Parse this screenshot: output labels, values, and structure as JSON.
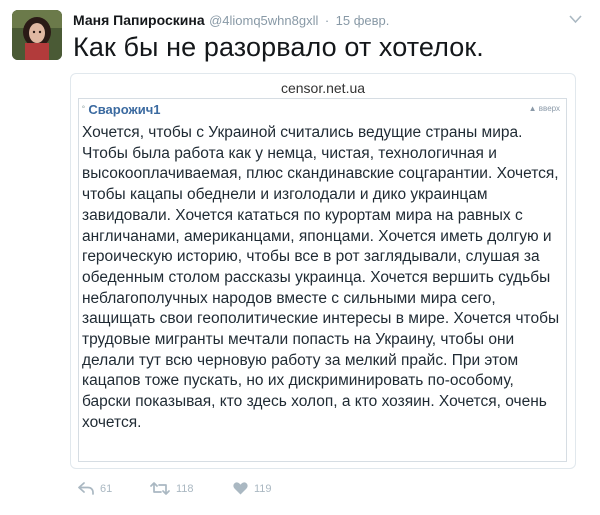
{
  "tweet": {
    "author_name": "Маня Папироскина",
    "author_handle": "@4liomq5whn8gxll",
    "date": "15 февр.",
    "text": "Как бы не разорвало от хотелок."
  },
  "card": {
    "source": "censor.net.ua",
    "comment_user": "Сварожич1",
    "up_link": "вверх",
    "comment_text": "Хочется, чтобы с Украиной считались ведущие страны мира. Чтобы была работа как у немца, чистая, технологичная и высокооплачиваемая, плюс скандинавские соцгарантии. Хочется, чтобы кацапы обеднели и изголодали и дико украинцам завидовали. Хочется кататься по курортам мира на равных с англичанами, американцами, японцами. Хочется иметь долгую и героическую историю, чтобы все в рот заглядывали, слушая за обеденным столом рассказы украинца. Хочется вершить судьбы неблагополучных народов вместе с сильными мира сего, защищать свои геополитические интересы в мире. Хочется чтобы трудовые мигранты мечтали попасть на Украину, чтобы они делали тут всю черновую работу за мелкий прайс. При этом кацапов тоже пускать, но их дискриминировать по-особому, барски показывая, кто здесь холоп, а кто хозяин. Хочется, очень хочется."
  },
  "actions": {
    "reply_count": "61",
    "retweet_count": "118",
    "like_count": "119"
  },
  "icons": {
    "reply": "reply-icon",
    "retweet": "retweet-icon",
    "like": "heart-icon",
    "more": "chevron-down-icon"
  },
  "colors": {
    "link": "#3b6aa0",
    "muted": "#8899a6",
    "icon": "#aab8c2"
  }
}
